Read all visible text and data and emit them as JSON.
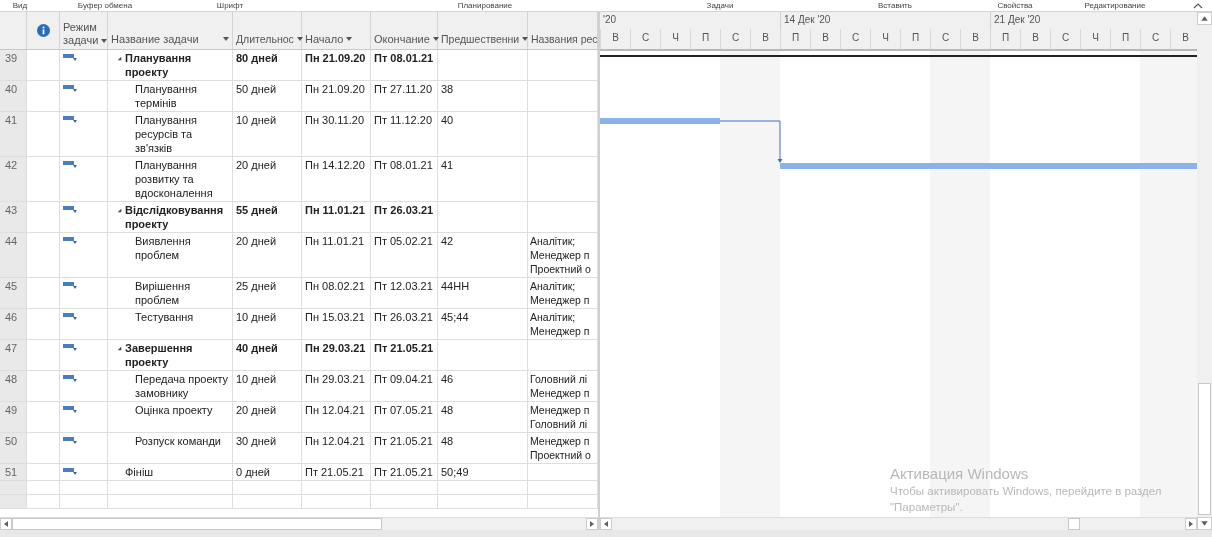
{
  "ribbon_groups": [
    "Вид",
    "Буфер обмена",
    "Шрифт",
    "Планирование",
    "Задачи",
    "Вставить",
    "Свойства",
    "Редактирование"
  ],
  "table": {
    "columns": [
      {
        "kind": "id"
      },
      {
        "kind": "info"
      },
      {
        "kind": "mode",
        "label": "Режим задачи"
      },
      {
        "kind": "name",
        "label": "Название задачи"
      },
      {
        "kind": "duration",
        "label": "Длительнос"
      },
      {
        "kind": "start",
        "label": "Начало"
      },
      {
        "kind": "finish",
        "label": "Окончание"
      },
      {
        "kind": "pred",
        "label": "Предшественни"
      },
      {
        "kind": "res",
        "label": "Названия рес"
      }
    ],
    "rows": [
      {
        "id": "39",
        "name": "Планування проекту",
        "duration": "80 дней",
        "start": "Пн 21.09.20",
        "finish": "Пт 08.01.21",
        "expanded": true,
        "children": [
          {
            "id": "40",
            "name": "Планування термінів",
            "duration": "50 дней",
            "start": "Пн 21.09.20",
            "finish": "Пт 27.11.20",
            "predecessors": "38"
          },
          {
            "id": "41",
            "name": "Планування ресурсів та зв'язків",
            "duration": "10 дней",
            "start": "Пн 30.11.20",
            "finish": "Пт 11.12.20",
            "predecessors": "40"
          },
          {
            "id": "42",
            "name": "Планування розвитку та вдосконалення",
            "duration": "20 дней",
            "start": "Пн 14.12.20",
            "finish": "Пт 08.01.21",
            "predecessors": "41"
          }
        ]
      },
      {
        "id": "43",
        "name": "Відслідковування проекту",
        "duration": "55 дней",
        "start": "Пн 11.01.21",
        "finish": "Пт 26.03.21",
        "expanded": true,
        "children": [
          {
            "id": "44",
            "name": "Виявлення проблем",
            "duration": "20 дней",
            "start": "Пн 11.01.21",
            "finish": "Пт 05.02.21",
            "predecessors": "42",
            "resources": [
              "Аналітик;",
              "Менеджер п",
              "Проектний о"
            ]
          },
          {
            "id": "45",
            "name": "Вирішення проблем",
            "duration": "25 дней",
            "start": "Пн 08.02.21",
            "finish": "Пт 12.03.21",
            "predecessors": "44НН",
            "resources": [
              "Аналітик;",
              "Менеджер п"
            ]
          },
          {
            "id": "46",
            "name": "Тестування",
            "duration": "10 дней",
            "start": "Пн 15.03.21",
            "finish": "Пт 26.03.21",
            "predecessors": "45;44",
            "resources": [
              "Аналітик;",
              "Менеджер п"
            ]
          }
        ]
      },
      {
        "id": "47",
        "name": "Завершення проекту",
        "duration": "40 дней",
        "start": "Пн 29.03.21",
        "finish": "Пт 21.05.21",
        "expanded": true,
        "children": [
          {
            "id": "48",
            "name": "Передача проекту замовнику",
            "duration": "10 дней",
            "start": "Пн 29.03.21",
            "finish": "Пт 09.04.21",
            "predecessors": "46",
            "resources": [
              "Головний лі",
              "Менеджер п"
            ]
          },
          {
            "id": "49",
            "name": "Оцінка проекту",
            "duration": "20 дней",
            "start": "Пн 12.04.21",
            "finish": "Пт 07.05.21",
            "predecessors": "48",
            "resources": [
              "Менеджер п",
              "Головний лі"
            ]
          },
          {
            "id": "50",
            "name": "Розпуск команди",
            "duration": "30 дней",
            "start": "Пн 12.04.21",
            "finish": "Пт 21.05.21",
            "predecessors": "48",
            "resources": [
              "Менеджер п",
              "Проектний о"
            ]
          }
        ]
      },
      {
        "id": "51",
        "name": "Фініш",
        "duration": "0 дней",
        "start": "Пт 21.05.21",
        "finish": "Пт 21.05.21",
        "predecessors": "50;49"
      }
    ]
  },
  "timescale": [
    {
      "label": "'20",
      "days": [
        "В",
        "С",
        "Ч",
        "П",
        "С",
        "В"
      ]
    },
    {
      "label": "14 Дек '20",
      "days": [
        "П",
        "В",
        "С",
        "Ч",
        "П",
        "С",
        "В"
      ]
    },
    {
      "label": "21 Дек '20",
      "days": [
        "П",
        "В",
        "С",
        "Ч",
        "П",
        "С",
        "В"
      ]
    }
  ],
  "activation_notice": {
    "title": "Активация Windows",
    "text": "Чтобы активировать Windows, перейдите в раздел \"Параметры\"."
  }
}
